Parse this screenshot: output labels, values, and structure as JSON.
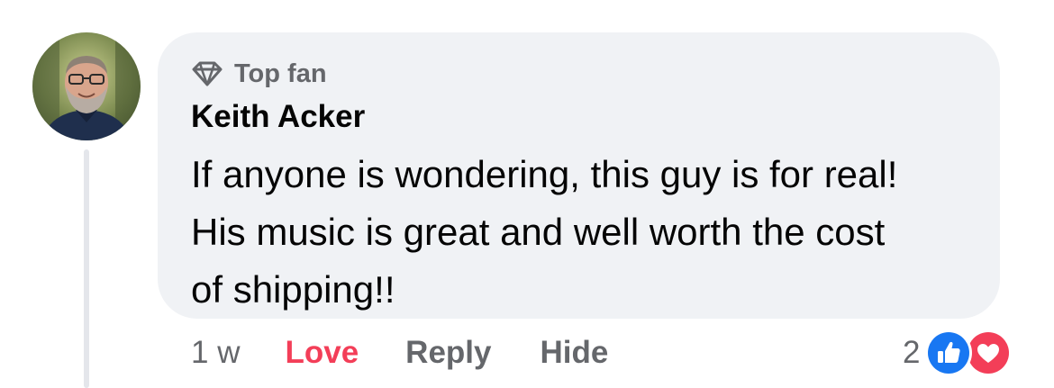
{
  "comment": {
    "badge": "Top fan",
    "author": "Keith Acker",
    "text_lines": [
      "If anyone is wondering, this guy is for real!",
      "His music is great and well worth the cost",
      "of shipping!!"
    ]
  },
  "actions": {
    "time": "1 w",
    "love_label": "Love",
    "reply_label": "Reply",
    "hide_label": "Hide"
  },
  "reactions": {
    "count": "2",
    "types": [
      "like-icon",
      "love-heart-icon"
    ]
  },
  "colors": {
    "bubble_bg": "#f0f2f5",
    "secondary_text": "#65676b",
    "love_active": "#f33e58",
    "like_blue": "#1877f2",
    "heart_red": "#f33e58"
  },
  "icons": {
    "badge_icon": "diamond-icon",
    "avatar": "avatar"
  }
}
